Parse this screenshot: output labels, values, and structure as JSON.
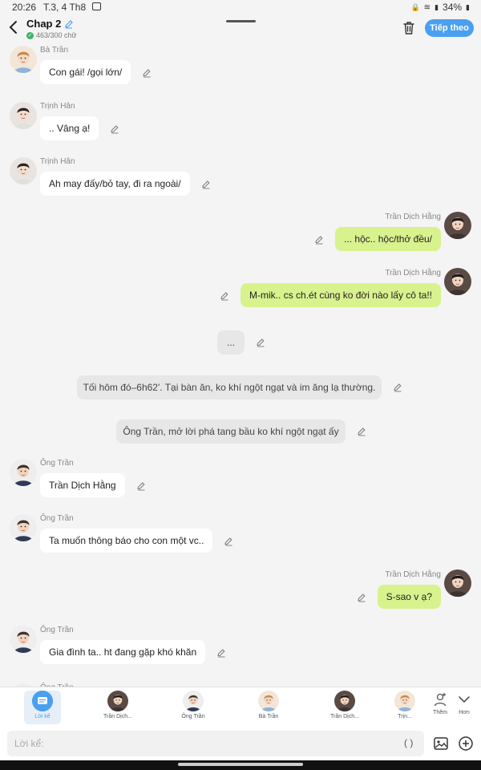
{
  "status": {
    "time": "20:26",
    "date": "T.3, 4 Th8",
    "battery": "34%"
  },
  "header": {
    "title": "Chap 2",
    "count": "463/300 chữ",
    "next_label": "Tiếp theo"
  },
  "messages": [
    {
      "side": "left",
      "sender": "Bà Trần",
      "text": "Con gái! /gọi lớn/",
      "avatar": "ba-tran"
    },
    {
      "side": "left",
      "sender": "Trịnh Hân",
      "text": ".. Vâng ạ!",
      "avatar": "trinh-han"
    },
    {
      "side": "left",
      "sender": "Trịnh Hân",
      "text": "Ah may đấy/bỏ tay, đi ra ngoài/",
      "avatar": "trinh-han"
    },
    {
      "side": "right",
      "sender": "Trần Dịch Hằng",
      "text": "... hộc.. hộc/thở đều/",
      "avatar": "tran-dich-hang"
    },
    {
      "side": "right",
      "sender": "Trần Dịch Hằng",
      "text": "M-mik.. cs ch.ét cùng ko đời nào lấy cô ta!!",
      "avatar": "tran-dich-hang"
    },
    {
      "side": "center",
      "text": "..."
    },
    {
      "side": "center",
      "text": "Tối hôm đó–6h62'. Tại bàn ăn, ko khí ngột ngạt và im ăng lạ thường."
    },
    {
      "side": "center",
      "text": "Ông Trần, mở lời phá tang bầu ko khí ngột ngạt ấy"
    },
    {
      "side": "left",
      "sender": "Ông Trần",
      "text": "Trần Dịch Hằng",
      "avatar": "ong-tran"
    },
    {
      "side": "left",
      "sender": "Ông Trần",
      "text": "Ta muốn thông báo cho con một vc..",
      "avatar": "ong-tran"
    },
    {
      "side": "right",
      "sender": "Trần Dịch Hằng",
      "text": "S-sao v ạ?",
      "avatar": "tran-dich-hang"
    },
    {
      "side": "left",
      "sender": "Ông Trần",
      "text": "Gia đình ta.. ht đang gặp khó khăn",
      "avatar": "ong-tran"
    },
    {
      "side": "left",
      "sender": "Ông Trần",
      "text": "",
      "avatar": "ong-tran"
    }
  ],
  "characters": [
    {
      "label": "Lời kể",
      "selected": true
    },
    {
      "label": "Trần Dịch..."
    },
    {
      "label": "Ông Trần"
    },
    {
      "label": "Bà Trần"
    },
    {
      "label": "Trần Dịch..."
    },
    {
      "label": "Trịn..."
    }
  ],
  "side_buttons": {
    "add_label": "Thêm",
    "more_label": "Hơn"
  },
  "input": {
    "placeholder": "Lời kể:",
    "paren": "( )"
  },
  "colors": {
    "accent": "#4a9ff0",
    "right_bubble": "#d8f28e",
    "narration": "#e7e7e7"
  }
}
